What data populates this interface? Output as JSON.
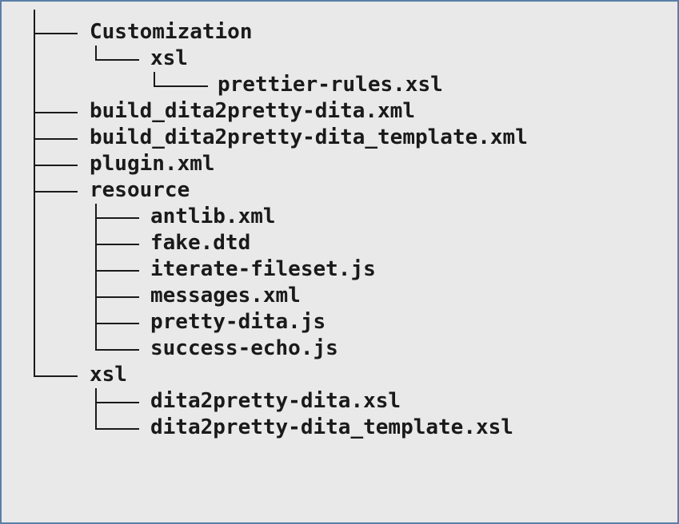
{
  "tree": {
    "lines": [
      {
        "depth": 1,
        "text": "Customization",
        "last": false
      },
      {
        "depth": 2,
        "text": "xsl",
        "last": true
      },
      {
        "depth": 3,
        "text": "prettier-rules.xsl",
        "last": true
      },
      {
        "depth": 1,
        "text": "build_dita2pretty-dita.xml",
        "last": false
      },
      {
        "depth": 1,
        "text": "build_dita2pretty-dita_template.xml",
        "last": false
      },
      {
        "depth": 1,
        "text": "plugin.xml",
        "last": false
      },
      {
        "depth": 1,
        "text": "resource",
        "last": false
      },
      {
        "depth": 2,
        "text": "antlib.xml",
        "last": false
      },
      {
        "depth": 2,
        "text": "fake.dtd",
        "last": false
      },
      {
        "depth": 2,
        "text": "iterate-fileset.js",
        "last": false
      },
      {
        "depth": 2,
        "text": "messages.xml",
        "last": false
      },
      {
        "depth": 2,
        "text": "pretty-dita.js",
        "last": false
      },
      {
        "depth": 2,
        "text": "success-echo.js",
        "last": true
      },
      {
        "depth": 1,
        "text": "xsl",
        "last": true
      },
      {
        "depth": 2,
        "text": "dita2pretty-dita.xsl",
        "last": false
      },
      {
        "depth": 2,
        "text": "dita2pretty-dita_template.xsl",
        "last": true
      }
    ]
  },
  "colors": {
    "background": "#e9e9e9",
    "text": "#1a1a1a",
    "border": "#5a7fa6"
  }
}
